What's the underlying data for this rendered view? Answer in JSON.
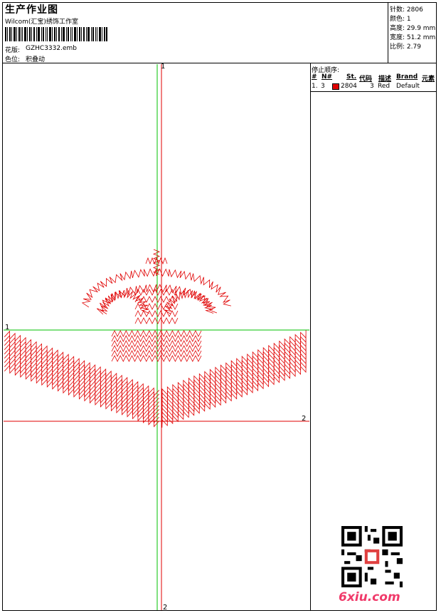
{
  "header": {
    "title": "生产作业图",
    "studio": "Wilcom(汇宝)绣饰工作室",
    "design_label": "花版:",
    "design_value": "GZHC3332.emb",
    "color_label": "色位:",
    "color_value": "积叠动"
  },
  "stats": {
    "stitches": "针数: 2806",
    "colors": "颜色: 1",
    "height": "高度: 29.9 mm",
    "width": "宽度: 51.2 mm",
    "ratio": "比例: 2.79"
  },
  "sequence": {
    "heading": "停止顺序:",
    "columns": [
      "#",
      "N#",
      "St.",
      "代码",
      "描述",
      "Brand",
      "元素"
    ],
    "rows": [
      {
        "idx": "1.",
        "n": "3",
        "color": "#e00000",
        "st": "2804",
        "code": "3",
        "desc": "Red",
        "brand": "Default",
        "element": ""
      }
    ]
  },
  "axes": {
    "top": "1",
    "left": "1",
    "right": "2",
    "bottom": "2"
  },
  "design": {
    "thread_color": "#e00000",
    "guide_green": "#00c000",
    "guide_red": "#e00000"
  },
  "watermark": "6xiu.com"
}
